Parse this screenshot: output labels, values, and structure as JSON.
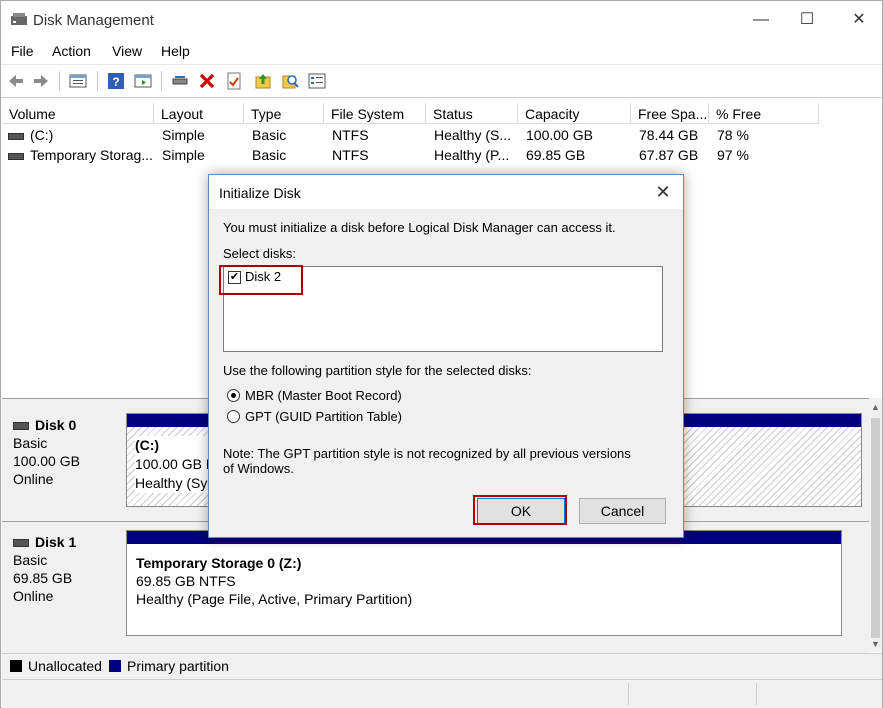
{
  "window": {
    "title": "Disk Management"
  },
  "menu": [
    "File",
    "Action",
    "View",
    "Help"
  ],
  "columns": [
    "Volume",
    "Layout",
    "Type",
    "File System",
    "Status",
    "Capacity",
    "Free Spa...",
    "% Free"
  ],
  "volumes": [
    {
      "volume": "(C:)",
      "layout": "Simple",
      "type": "Basic",
      "fs": "NTFS",
      "status": "Healthy (S...",
      "capacity": "100.00 GB",
      "free": "78.44 GB",
      "pct": "78 %"
    },
    {
      "volume": "Temporary Storag...",
      "layout": "Simple",
      "type": "Basic",
      "fs": "NTFS",
      "status": "Healthy (P...",
      "capacity": "69.85 GB",
      "free": "67.87 GB",
      "pct": "97 %"
    }
  ],
  "disks": [
    {
      "name": "Disk 0",
      "kind": "Basic",
      "size": "100.00 GB",
      "state": "Online",
      "partition": {
        "label": "(C:)",
        "line2": "100.00 GB N",
        "line3": "Healthy (Sys"
      }
    },
    {
      "name": "Disk 1",
      "kind": "Basic",
      "size": "69.85 GB",
      "state": "Online",
      "partition": {
        "label": "Temporary Storage 0  (Z:)",
        "line2": "69.85 GB NTFS",
        "line3": "Healthy (Page File, Active, Primary Partition)"
      }
    }
  ],
  "legend": {
    "unallocated": "Unallocated",
    "primary": "Primary partition"
  },
  "dialog": {
    "title": "Initialize Disk",
    "intro": "You must initialize a disk before Logical Disk Manager can access it.",
    "select_label": "Select disks:",
    "disk_item": "Disk 2",
    "style_label": "Use the following partition style for the selected disks:",
    "mbr": "MBR (Master Boot Record)",
    "gpt": "GPT (GUID Partition Table)",
    "note": "Note: The GPT partition style is not recognized by all previous versions of Windows.",
    "ok": "OK",
    "cancel": "Cancel"
  },
  "colors": {
    "primary_partition": "#00007f",
    "unallocated": "#000000",
    "highlight": "#b00000"
  }
}
